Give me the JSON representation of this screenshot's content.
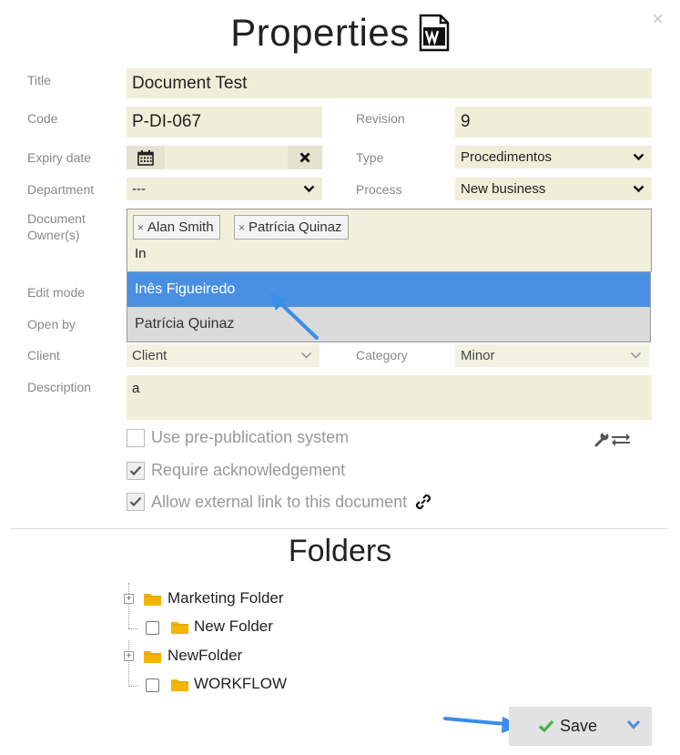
{
  "dialog": {
    "title": "Properties",
    "close_symbol": "×"
  },
  "form": {
    "title": {
      "label": "Title",
      "value": "Document Test"
    },
    "code": {
      "label": "Code",
      "value": "P-DI-067"
    },
    "revision": {
      "label": "Revision",
      "value": "9"
    },
    "expiry_date": {
      "label": "Expiry date",
      "value": ""
    },
    "type": {
      "label": "Type",
      "value": "Procedimentos"
    },
    "department": {
      "label": "Department",
      "value": "---"
    },
    "process": {
      "label": "Process",
      "value": "New business"
    },
    "owners": {
      "label": "Document Owner(s)",
      "tags": [
        "Alan Smith",
        "Patrícia Quinaz"
      ],
      "input_value": "In",
      "suggestions": [
        "Inês Figueiredo",
        "Patrícia Quinaz"
      ]
    },
    "edit_mode": {
      "label": "Edit mode"
    },
    "open_by": {
      "label": "Open by"
    },
    "client": {
      "label": "Client",
      "value": "Client"
    },
    "category": {
      "label": "Category",
      "value": "Minor"
    },
    "description": {
      "label": "Description",
      "value": "a"
    },
    "checkboxes": [
      {
        "label": "Use pre-publication system",
        "checked": false
      },
      {
        "label": "Require acknowledgement",
        "checked": true
      },
      {
        "label": "Allow external link to this document",
        "checked": true
      }
    ]
  },
  "folders": {
    "title": "Folders",
    "items": [
      {
        "label": "Marketing Folder",
        "level": 0,
        "expandable": true
      },
      {
        "label": "New Folder",
        "level": 1,
        "checkbox": true
      },
      {
        "label": "NewFolder",
        "level": 0,
        "expandable": true
      },
      {
        "label": "WORKFLOW",
        "level": 1,
        "checkbox": true
      }
    ]
  },
  "footer": {
    "save_label": "Save"
  },
  "colors": {
    "field_bg": "#efefd9",
    "highlight": "#4a90e2",
    "arrow": "#3a8ee6",
    "folder": "#f4b400",
    "check_green": "#4cae4c"
  },
  "icons": [
    "word-document-icon",
    "close-icon",
    "calendar-icon",
    "clear-icon",
    "chevron-down-icon",
    "wrench-icon",
    "swap-arrows-icon",
    "link-icon",
    "folder-icon",
    "expand-plus-icon",
    "checkmark-icon"
  ]
}
